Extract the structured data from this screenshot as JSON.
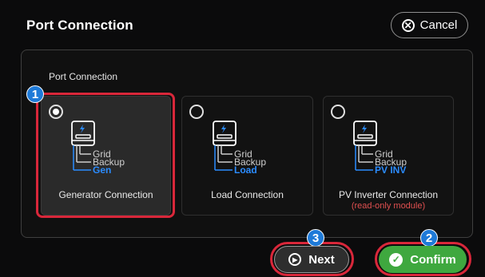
{
  "header": {
    "title": "Port Connection",
    "cancel_label": "Cancel"
  },
  "panel": {
    "label": "Port Connection"
  },
  "cards": [
    {
      "label": "Generator Connection",
      "sub": "",
      "selected": true,
      "lines": [
        "Grid",
        "Backup",
        "Gen"
      ]
    },
    {
      "label": "Load Connection",
      "sub": "",
      "selected": false,
      "lines": [
        "Grid",
        "Backup",
        "Load"
      ]
    },
    {
      "label": "PV Inverter Connection",
      "sub": "(read-only module)",
      "selected": false,
      "lines": [
        "Grid",
        "Backup",
        "PV INV"
      ]
    }
  ],
  "footer": {
    "next_label": "Next",
    "confirm_label": "Confirm"
  },
  "badges": [
    "1",
    "2",
    "3"
  ],
  "colors": {
    "accent_blue": "#1e7ad8",
    "confirm_green": "#3fa83f",
    "highlight_red": "#d9273a",
    "warning_red": "#e05050"
  },
  "icons": {
    "cancel": "x-circle-icon",
    "next": "play-circle-icon",
    "confirm": "check-circle-icon",
    "device": "inverter-icon"
  }
}
